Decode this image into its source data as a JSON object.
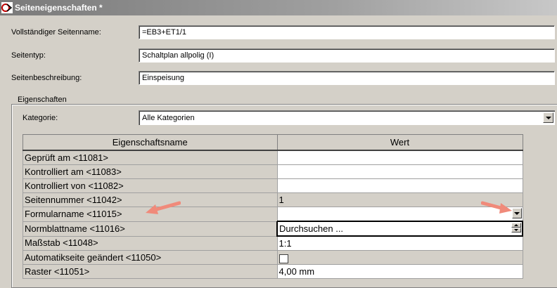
{
  "window": {
    "title": "Seiteneigenschaften *"
  },
  "fields": {
    "full_name": {
      "label": "Vollständiger Seitenname:",
      "value": "=EB3+ET1/1"
    },
    "page_type": {
      "label": "Seitentyp:",
      "value": "Schaltplan allpolig (I)"
    },
    "page_description": {
      "label": "Seitenbeschreibung:",
      "value": "Einspeisung"
    }
  },
  "properties": {
    "group_title": "Eigenschaften",
    "category_label": "Kategorie:",
    "category_value": "Alle Kategorien",
    "columns": {
      "name": "Eigenschaftsname",
      "value": "Wert"
    },
    "rows": [
      {
        "name": "Geprüft am <11081>",
        "value": ""
      },
      {
        "name": "Kontrolliert am <11083>",
        "value": ""
      },
      {
        "name": "Kontrolliert von <11082>",
        "value": ""
      },
      {
        "name": "Seitennummer <11042>",
        "value": "1"
      },
      {
        "name": "Formularname <11015>",
        "value": ""
      },
      {
        "name": "Normblattname <11016>",
        "value": "Durchsuchen ..."
      },
      {
        "name": "Maßstab <11048>",
        "value": "1:1"
      },
      {
        "name": "Automatikseite geändert <11050>",
        "value": ""
      },
      {
        "name": "Raster <11051>",
        "value": "4,00 mm"
      }
    ]
  },
  "colors": {
    "annotation_arrow": "#f08a7a"
  },
  "icons": {
    "app": "app-icon",
    "dropdown": "chevron-down-icon",
    "spinner": "spinner-icon",
    "checkbox": "checkbox-icon"
  }
}
